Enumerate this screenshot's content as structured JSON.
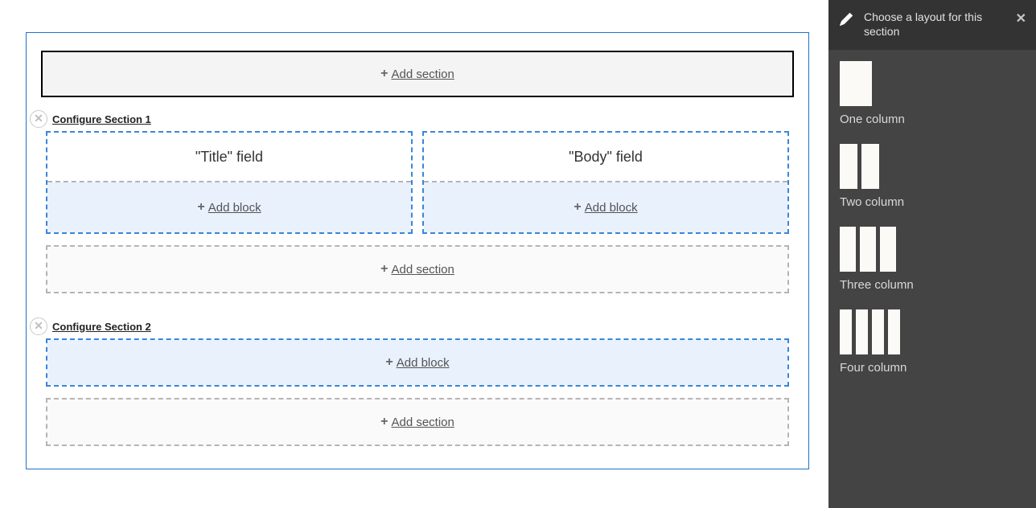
{
  "main": {
    "add_section_label": "Add section",
    "add_block_label": "Add block",
    "sections": [
      {
        "configure_label": "Configure Section 1",
        "columns": [
          {
            "block_label": "\"Title\" field"
          },
          {
            "block_label": "\"Body\" field"
          }
        ]
      },
      {
        "configure_label": "Configure Section 2",
        "columns": []
      }
    ]
  },
  "panel": {
    "title": "Choose a layout for this section",
    "options": [
      {
        "label": "One column",
        "cols": 1
      },
      {
        "label": "Two column",
        "cols": 2
      },
      {
        "label": "Three column",
        "cols": 3
      },
      {
        "label": "Four column",
        "cols": 4
      }
    ]
  }
}
